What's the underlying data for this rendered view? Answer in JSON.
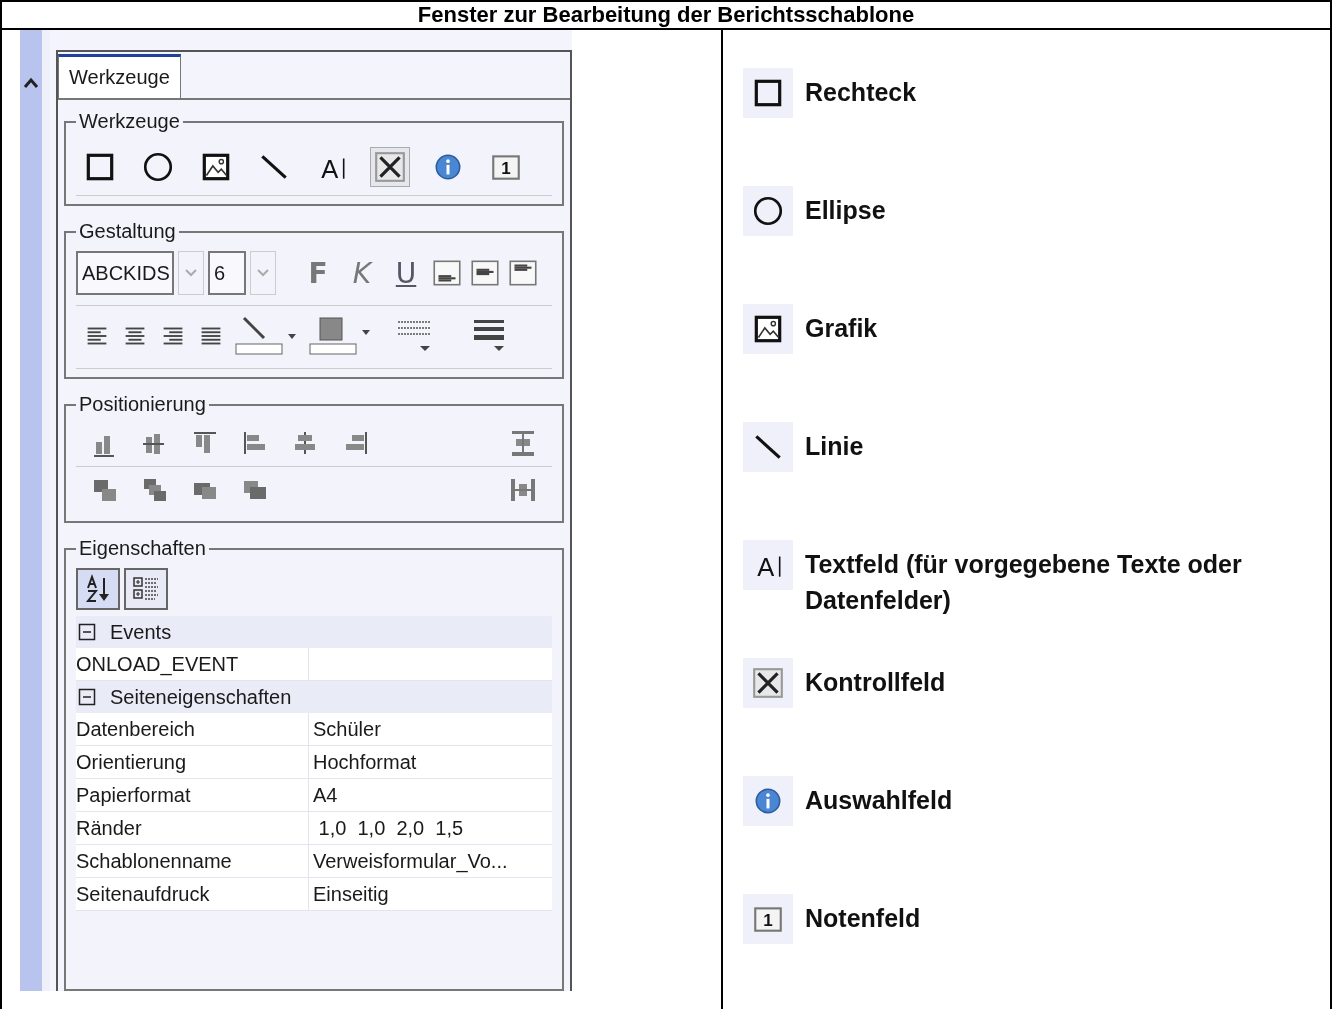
{
  "title": "Fenster zur Bearbeitung der Berichtsschablone",
  "panel": {
    "tabs": [
      {
        "label": "Werkzeuge",
        "selected": true
      }
    ],
    "groups": {
      "tools": {
        "title": "Werkzeuge",
        "items": [
          {
            "kind": "rectangle",
            "selected": false
          },
          {
            "kind": "ellipse",
            "selected": false
          },
          {
            "kind": "image",
            "selected": false
          },
          {
            "kind": "line",
            "selected": false
          },
          {
            "kind": "textfield",
            "selected": false,
            "icon_text": "A"
          },
          {
            "kind": "checkbox",
            "selected": true
          },
          {
            "kind": "info",
            "selected": false
          },
          {
            "kind": "number",
            "selected": false,
            "icon_text": "1"
          }
        ]
      },
      "design": {
        "title": "Gestaltung",
        "font": "ABCKIDS",
        "size": "6",
        "styles": [
          {
            "kind": "bold",
            "label": "F"
          },
          {
            "kind": "italic",
            "label": "K"
          },
          {
            "kind": "underline",
            "label": "U"
          }
        ]
      },
      "positioning": {
        "title": "Positionierung"
      },
      "properties": {
        "title": "Eigenschaften",
        "sort_buttons": [
          {
            "kind": "alphabetical",
            "selected": true
          },
          {
            "kind": "categorized",
            "selected": false
          }
        ],
        "sections": [
          {
            "title": "Events",
            "expanded": true,
            "rows": [
              {
                "name": "ONLOAD_EVENT"
              }
            ]
          },
          {
            "title": "Seiteneigenschaften",
            "expanded": true,
            "rows": [
              {
                "name": "Datenbereich",
                "value": "Schüler"
              },
              {
                "name": "Orientierung",
                "value": "Hochformat"
              },
              {
                "name": "Papierformat",
                "value": "A4"
              },
              {
                "name": "Ränder",
                "value": " 1,0  1,0  2,0  1,5"
              },
              {
                "name": "Schablonenname",
                "value": "Verweisformular_Vo..."
              },
              {
                "name": "Seitenaufdruck",
                "value": "Einseitig"
              }
            ]
          }
        ]
      }
    }
  },
  "legend": [
    {
      "kind": "rectangle",
      "label": "Rechteck"
    },
    {
      "kind": "ellipse",
      "label": "Ellipse"
    },
    {
      "kind": "image",
      "label": "Grafik"
    },
    {
      "kind": "line",
      "label": "Linie"
    },
    {
      "kind": "textfield",
      "label": "Textfeld (für vorgegebene Texte oder Datenfelder)",
      "icon_text": "A"
    },
    {
      "kind": "checkbox",
      "label": "Kontrollfeld"
    },
    {
      "kind": "info",
      "label": "Auswahlfeld"
    },
    {
      "kind": "number",
      "label": "Notenfeld",
      "icon_text": "1"
    }
  ]
}
